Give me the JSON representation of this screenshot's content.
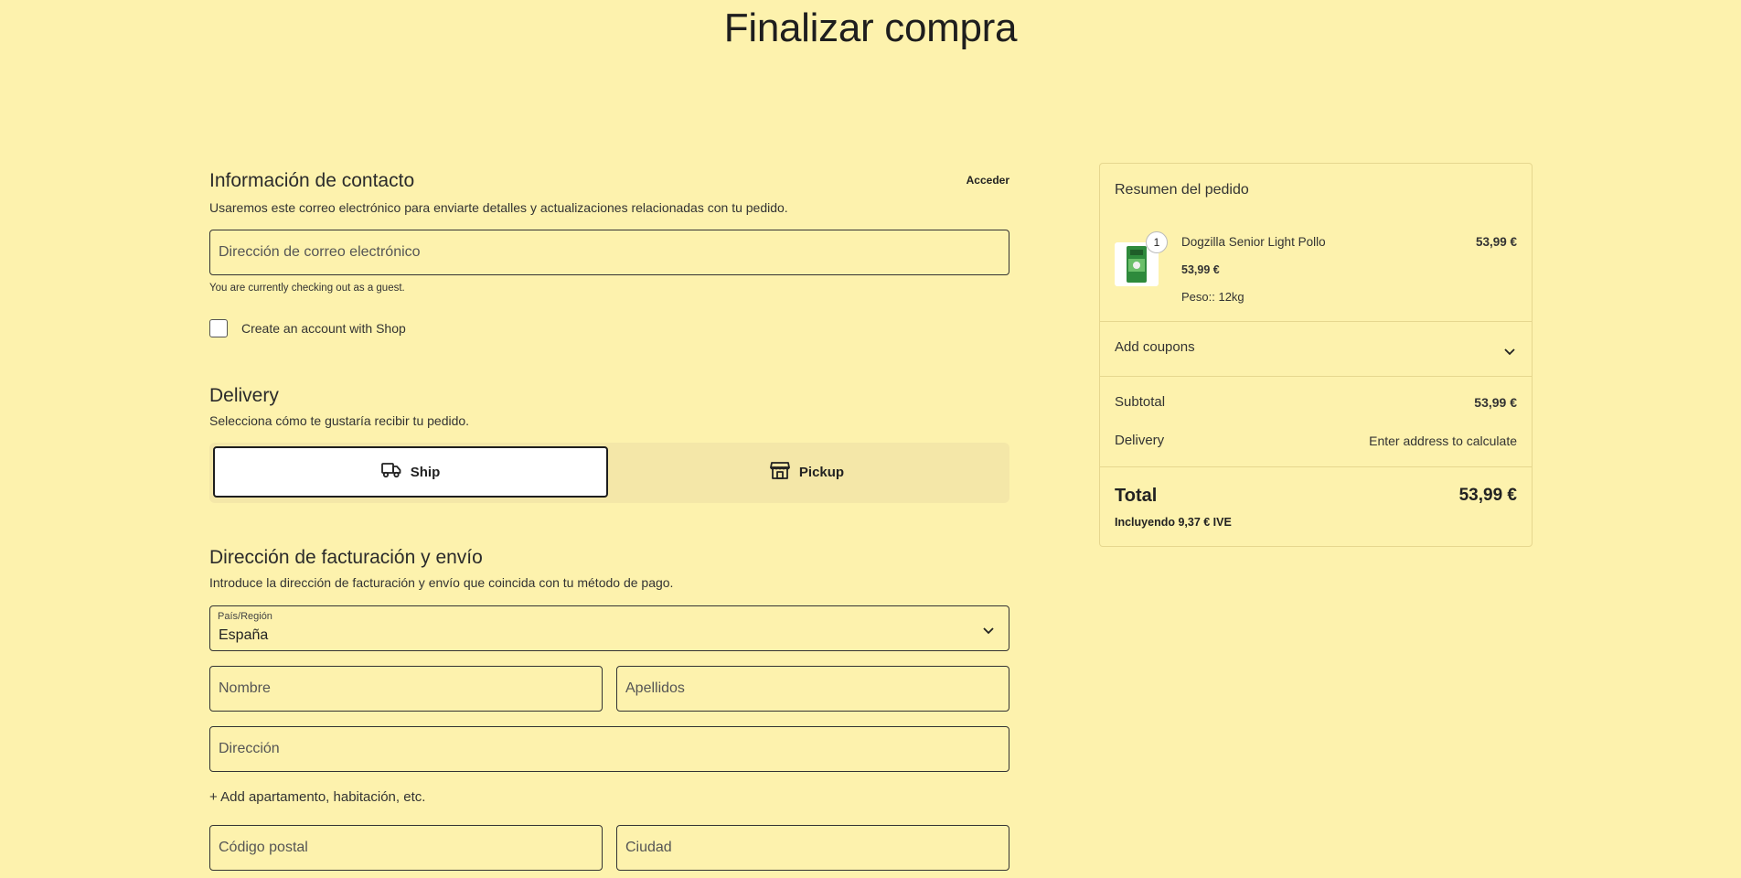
{
  "page": {
    "title": "Finalizar compra"
  },
  "contact": {
    "title": "Información de contacto",
    "description": "Usaremos este correo electrónico para enviarte detalles y actualizaciones relacionadas con tu pedido.",
    "login_label": "Acceder",
    "email_placeholder": "Dirección de correo electrónico",
    "guest_note": "You are currently checking out as a guest.",
    "create_account_label": "Create an account with Shop"
  },
  "delivery": {
    "title": "Delivery",
    "description": "Selecciona cómo te gustaría recibir tu pedido.",
    "options": [
      {
        "label": "Ship",
        "icon": "truck-icon",
        "selected": true
      },
      {
        "label": "Pickup",
        "icon": "store-icon",
        "selected": false
      }
    ]
  },
  "address": {
    "title": "Dirección de facturación y envío",
    "description": "Introduce la dirección de facturación y envío que coincida con tu método de pago.",
    "country_label": "País/Región",
    "country_value": "España",
    "first_name_placeholder": "Nombre",
    "last_name_placeholder": "Apellidos",
    "address_placeholder": "Dirección",
    "add_apartment_label": "+ Add apartamento, habitación, etc.",
    "postal_code_placeholder": "Código postal",
    "city_placeholder": "Ciudad"
  },
  "summary": {
    "title": "Resumen del pedido",
    "item": {
      "quantity": "1",
      "name": "Dogzilla Senior Light Pollo",
      "line_total": "53,99 €",
      "unit_price": "53,99 €",
      "attribute": "Peso:: 12kg"
    },
    "coupons_label": "Add coupons",
    "subtotal_label": "Subtotal",
    "subtotal_value": "53,99 €",
    "delivery_label": "Delivery",
    "delivery_value": "Enter address to calculate",
    "total_label": "Total",
    "total_value": "53,99 €",
    "tax_note": "Incluyendo 9,37 € IVE"
  },
  "colors": {
    "background": "#fdf2ad",
    "border": "#333333",
    "card_border": "#e6d78f"
  }
}
